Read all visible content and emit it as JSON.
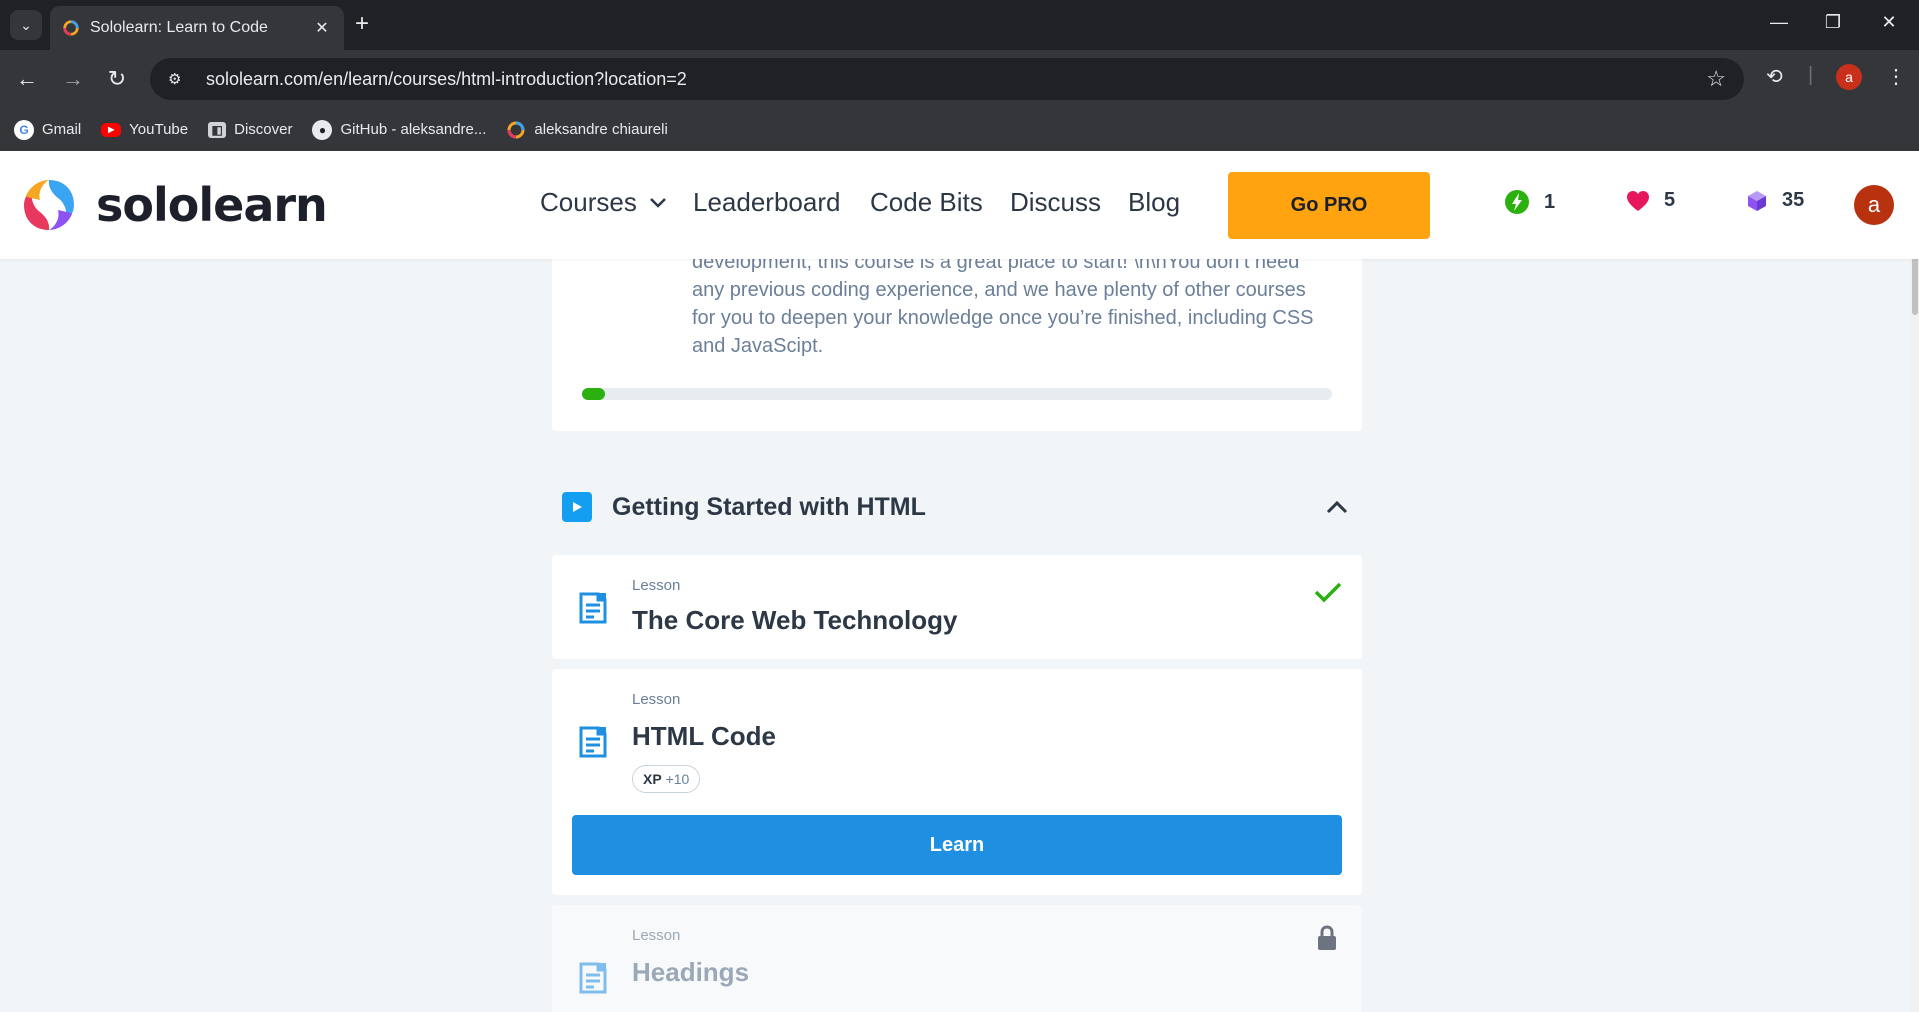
{
  "browser": {
    "tab_title": "Sololearn: Learn to Code",
    "url": "sololearn.com/en/learn/courses/html-introduction?location=2",
    "profile_initial": "a",
    "bookmarks": [
      {
        "label": "Gmail",
        "icon": "google-icon"
      },
      {
        "label": "YouTube",
        "icon": "youtube-icon"
      },
      {
        "label": "Discover",
        "icon": "discover-icon"
      },
      {
        "label": "GitHub - aleksandre...",
        "icon": "github-icon"
      },
      {
        "label": "aleksandre chiaureli",
        "icon": "sololearn-icon"
      }
    ]
  },
  "header": {
    "logo_text": "sololearn",
    "nav": {
      "courses": "Courses",
      "leaderboard": "Leaderboard",
      "code_bits": "Code Bits",
      "discuss": "Discuss",
      "blog": "Blog"
    },
    "go_pro": "Go PRO",
    "stats": {
      "streak": "1",
      "hearts": "5",
      "bits": "35"
    },
    "user_initial": "a"
  },
  "course": {
    "intro_text": "development, this course is a great place to start! \\n\\nYou don’t need any previous coding experience, and we have plenty of other courses for you to deepen your knowledge once you’re finished, including CSS and JavaScipt.",
    "progress": 0.03
  },
  "section": {
    "title": "Getting Started with HTML"
  },
  "lessons": [
    {
      "type": "Lesson",
      "title": "The Core Web Technology",
      "status": "completed"
    },
    {
      "type": "Lesson",
      "title": "HTML Code",
      "xp_label": "XP",
      "xp_value": "+10",
      "button": "Learn",
      "status": "current"
    },
    {
      "type": "Lesson",
      "title": "Headings",
      "status": "locked"
    }
  ],
  "colors": {
    "accent_blue": "#1e8fe1",
    "pro_orange": "#ffa310",
    "success_green": "#2bb10f"
  }
}
